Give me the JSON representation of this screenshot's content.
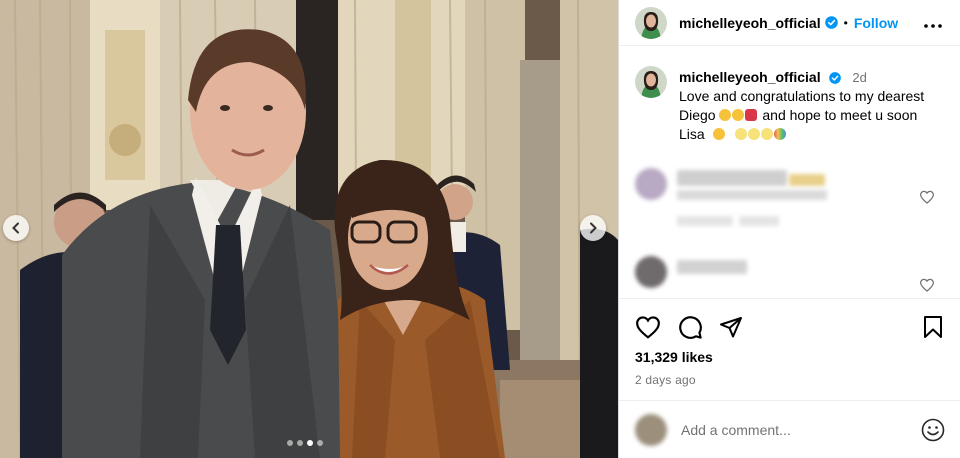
{
  "post": {
    "username": "michelleyeoh_official",
    "follow_label": "Follow",
    "more_label": "•••",
    "separator": "•"
  },
  "caption": {
    "username": "michelleyeoh_official",
    "time": "2d",
    "line1": "Love and congratulations to my dearest",
    "line2_a": "Diego",
    "line2_b": "and hope to meet u soon",
    "line3": "Lisa"
  },
  "stats": {
    "likes": "31,329 likes",
    "time_ago": "2 days ago"
  },
  "composer": {
    "placeholder": "Add a comment..."
  },
  "carousel": {
    "slide_count": 4,
    "active_index": 2
  },
  "colors": {
    "accent": "#0095f6",
    "secondary_text": "#737373",
    "border": "#dbdbdb"
  },
  "icons": [
    "chevron-left-icon",
    "chevron-right-icon",
    "verified-badge-icon",
    "heart-icon",
    "comment-icon",
    "share-icon",
    "bookmark-icon",
    "emoji-icon",
    "more-icon"
  ]
}
